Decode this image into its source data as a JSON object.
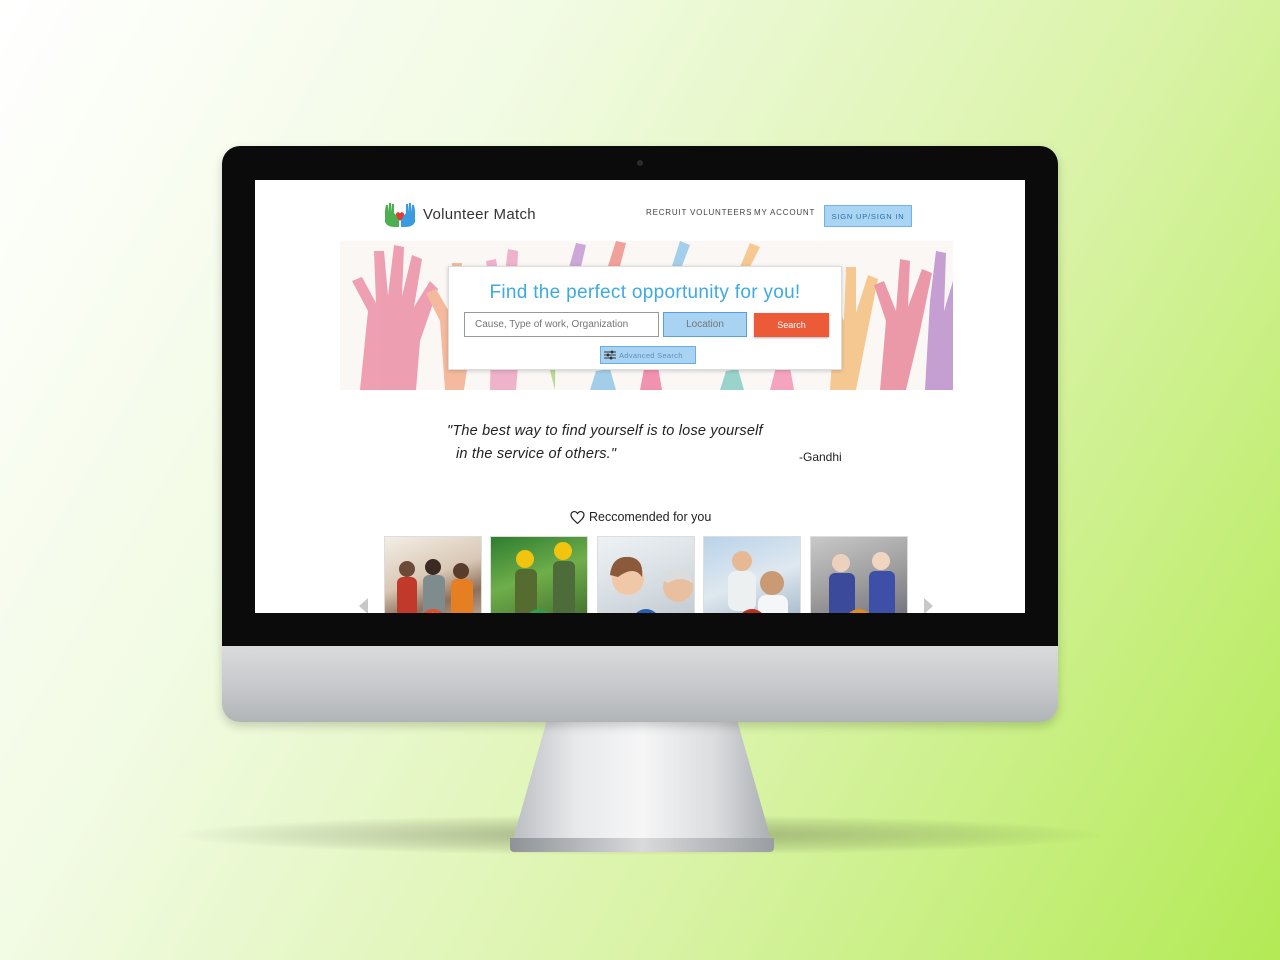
{
  "header": {
    "logo_text": "Volunteer Match",
    "nav_recruit": "RECRUIT VOLUNTEERS",
    "nav_account": "MY ACCOUNT",
    "nav_signup": "SIGN UP/SIGN IN"
  },
  "search": {
    "title": "Find the perfect opportunity for you!",
    "cause_placeholder": "Cause, Type of work, Organization",
    "location_placeholder": "Location",
    "search_label": "Search",
    "advanced_label": "Advanced Search"
  },
  "quote": {
    "line1": "\"The best way to find yourself is to lose yourself",
    "line2": "in the service of others.\"",
    "author": "-Gandhi"
  },
  "recommended": {
    "heading": "Reccomended for you",
    "cards": [
      {
        "photo": "group-of-volunteers-photo",
        "badge_icon": "hand-icon",
        "badge_color": "#e0502c"
      },
      {
        "photo": "forest-volunteers-photo",
        "badge_icon": "leaf-icon",
        "badge_color": "#2f9e4e"
      },
      {
        "photo": "caregiver-elderly-photo",
        "badge_icon": "people-icon",
        "badge_color": "#2a5fb0"
      },
      {
        "photo": "kitchen-volunteers-photo",
        "badge_icon": "chef-hat-icon",
        "badge_color": "#b8311f"
      },
      {
        "photo": "food-bank-volunteers-photo",
        "badge_icon": "spoon-icon",
        "badge_color": "#e08a1f"
      }
    ]
  },
  "colors": {
    "accent_blue": "#3eaadf",
    "search_orange": "#ec5a37",
    "highlight_blue": "#a9d3f3"
  }
}
